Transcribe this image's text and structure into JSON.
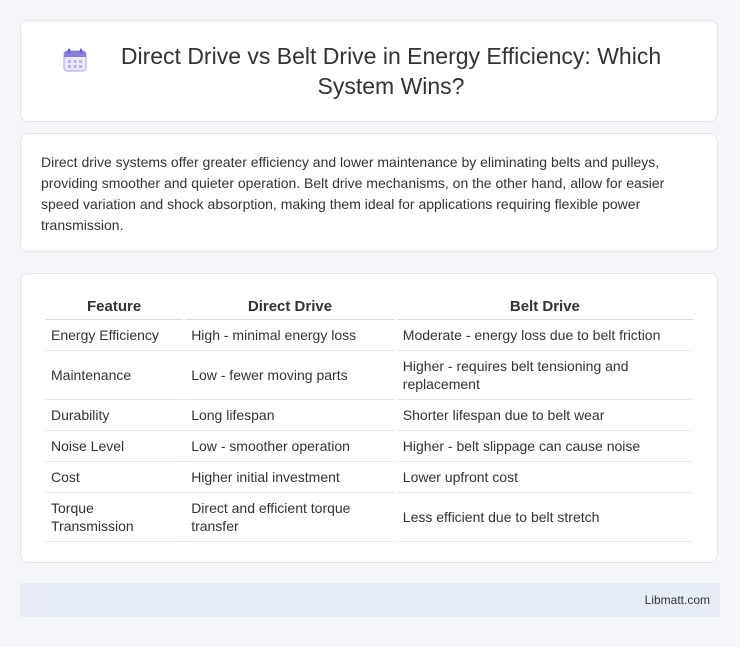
{
  "header": {
    "icon": "calendar-icon",
    "title": "Direct Drive vs Belt Drive in Energy Efficiency: Which System Wins?"
  },
  "intro": {
    "text": "Direct drive systems offer greater efficiency and lower maintenance by eliminating belts and pulleys, providing smoother and quieter operation. Belt drive mechanisms, on the other hand, allow for easier speed variation and shock absorption, making them ideal for applications requiring flexible power transmission."
  },
  "table": {
    "headers": [
      "Feature",
      "Direct Drive",
      "Belt Drive"
    ],
    "rows": [
      [
        "Energy Efficiency",
        "High - minimal energy loss",
        "Moderate - energy loss due to belt friction"
      ],
      [
        "Maintenance",
        "Low - fewer moving parts",
        "Higher - requires belt tensioning and replacement"
      ],
      [
        "Durability",
        "Long lifespan",
        "Shorter lifespan due to belt wear"
      ],
      [
        "Noise Level",
        "Low - smoother operation",
        "Higher - belt slippage can cause noise"
      ],
      [
        "Cost",
        "Higher initial investment",
        "Lower upfront cost"
      ],
      [
        "Torque Transmission",
        "Direct and efficient torque transfer",
        "Less efficient due to belt stretch"
      ]
    ]
  },
  "footer": {
    "site": "Libmatt.com"
  },
  "colors": {
    "page_background": "#f4f6f9",
    "footer_background": "#e6edf6",
    "icon_accent": "#8a7fd6"
  }
}
